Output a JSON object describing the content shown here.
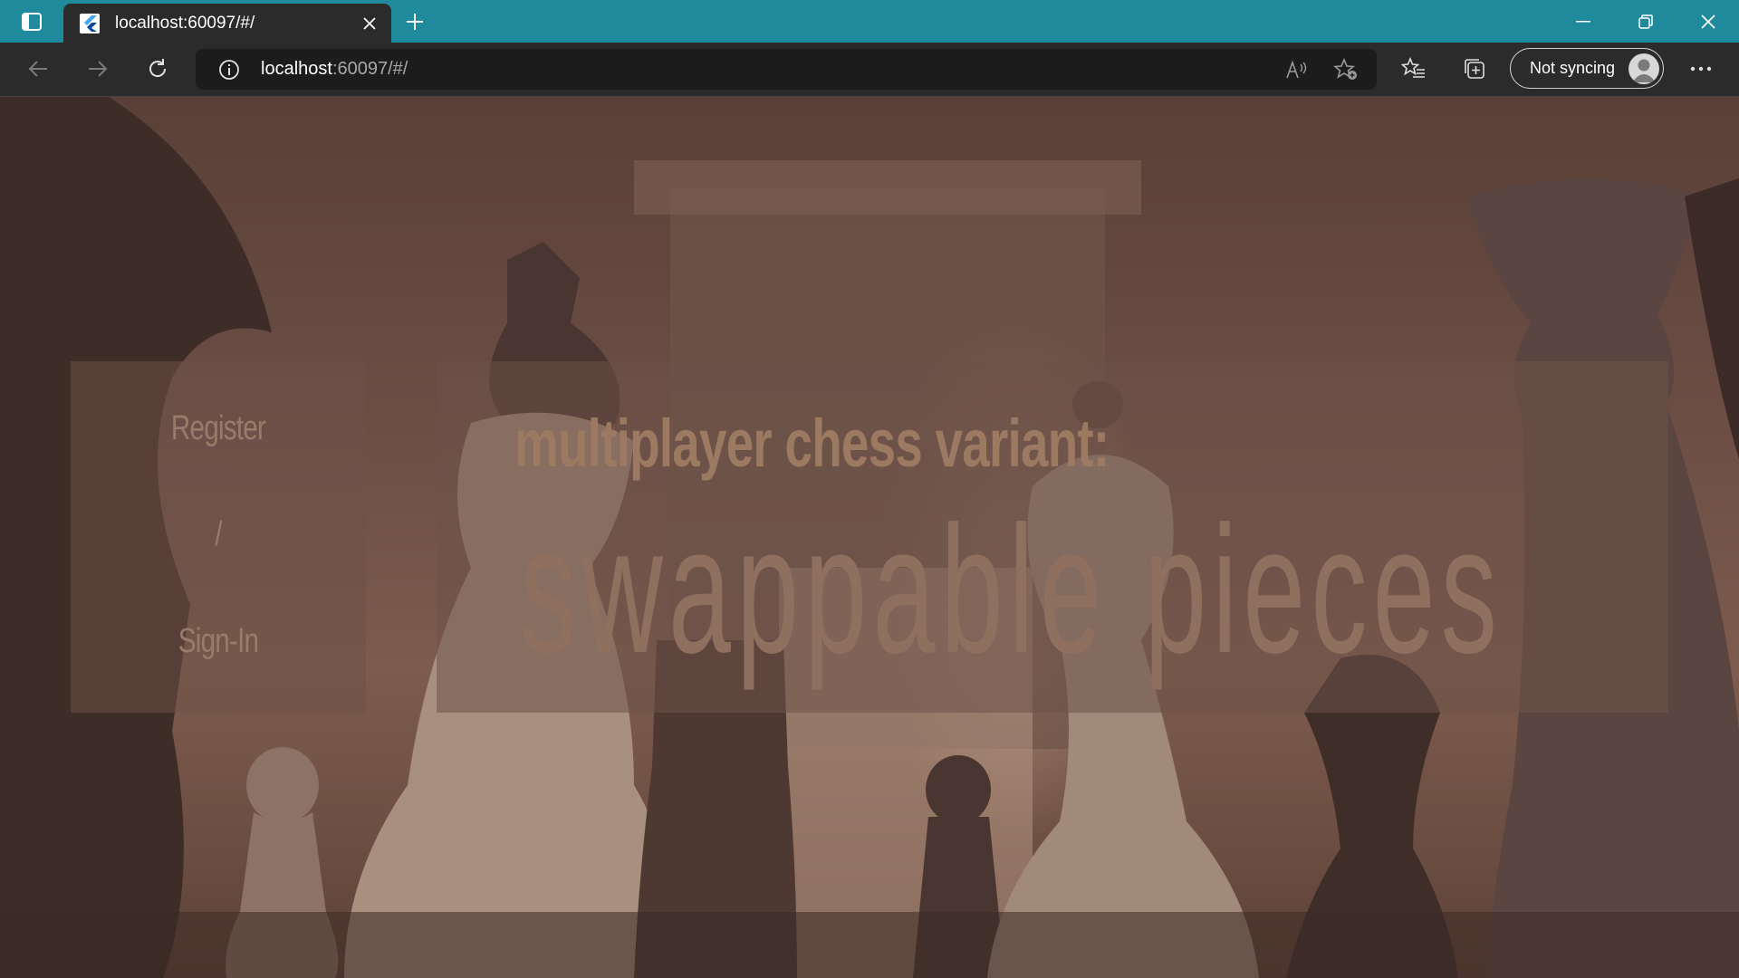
{
  "browser": {
    "tab_title": "localhost:60097/#/",
    "url_host": "localhost",
    "url_rest": ":60097/#/",
    "sync_label": "Not syncing"
  },
  "page": {
    "register_label": "Register",
    "separator": "/",
    "signin_label": "Sign-In",
    "headline": "multiplayer chess variant:",
    "subline": "swappable pieces"
  },
  "colors": {
    "titlebar": "#1f8a9c",
    "toolbar": "#2b2b2b",
    "panel": "#6e5248",
    "text_muted": "#9a7a68"
  }
}
